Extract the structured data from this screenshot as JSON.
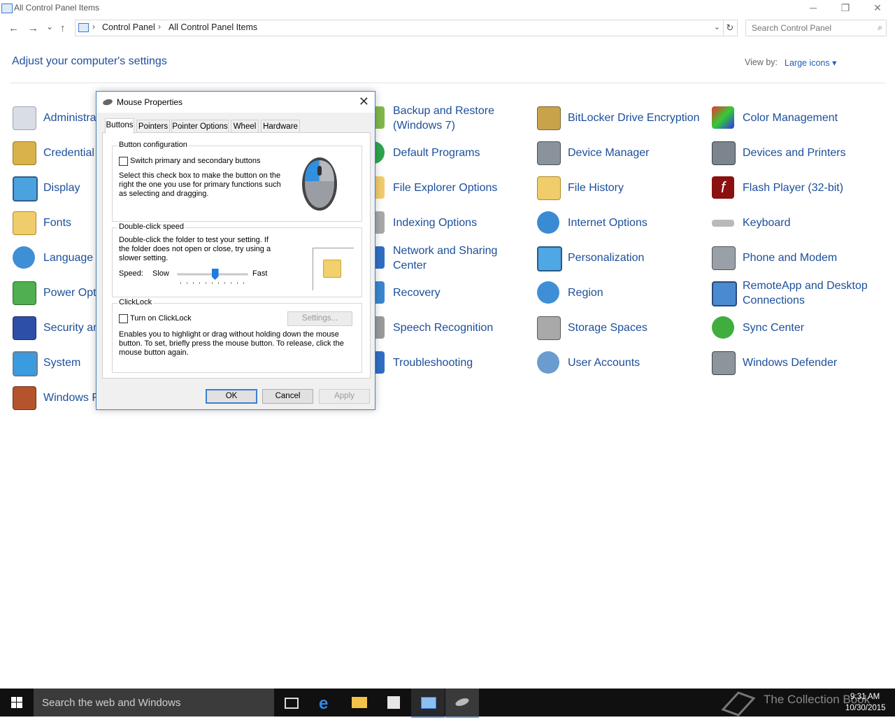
{
  "window": {
    "title": "All Control Panel Items",
    "min": "─",
    "restore": "❐",
    "close": "✕"
  },
  "nav": {
    "back": "←",
    "forward": "→",
    "recent": "⌄",
    "up": "↑"
  },
  "address": {
    "crumbs": [
      "Control Panel",
      "All Control Panel Items"
    ],
    "sep": "›",
    "refresh": "↻",
    "dropdown": "⌄"
  },
  "search": {
    "placeholder": "Search Control Panel",
    "icon": "⌕"
  },
  "heading": "Adjust your computer's settings",
  "view_by": {
    "label": "View by:",
    "value": "Large icons ▾"
  },
  "items": {
    "c0": [
      "Administrative Tools",
      "Credential Manager",
      "Display",
      "Fonts",
      "Language",
      "Power Options",
      "Security and Maintenance",
      "System",
      "Windows Firewall"
    ],
    "c2": [
      "Backup and Restore\n(Windows 7)",
      "Default Programs",
      "File Explorer Options",
      "Indexing Options",
      "Network and Sharing\nCenter",
      "Recovery",
      "Speech Recognition",
      "Troubleshooting"
    ],
    "c3": [
      "BitLocker Drive Encryption",
      "Device Manager",
      "File History",
      "Internet Options",
      "Personalization",
      "Region",
      "Storage Spaces",
      "User Accounts"
    ],
    "c4": [
      "Color Management",
      "Devices and Printers",
      "Flash Player (32-bit)",
      "Keyboard",
      "Phone and Modem",
      "RemoteApp and Desktop\nConnections",
      "Sync Center",
      "Windows Defender"
    ]
  },
  "dialog": {
    "title": "Mouse Properties",
    "close": "✕",
    "tabs": [
      "Buttons",
      "Pointers",
      "Pointer Options",
      "Wheel",
      "Hardware"
    ],
    "button_config": {
      "legend": "Button configuration",
      "checkbox": "Switch primary and secondary buttons",
      "desc": "Select this check box to make the button on the right the one you use for primary functions such as selecting and dragging."
    },
    "double_click": {
      "legend": "Double-click speed",
      "desc": "Double-click the folder to test your setting. If the folder does not open or close, try using a slower setting.",
      "speed_label": "Speed:",
      "slow": "Slow",
      "fast": "Fast",
      "speed_value": 0.55
    },
    "clicklock": {
      "legend": "ClickLock",
      "checkbox": "Turn on ClickLock",
      "settings": "Settings...",
      "desc": "Enables you to highlight or drag without holding down the mouse button. To set, briefly press the mouse button. To release, click the mouse button again."
    },
    "ok": "OK",
    "cancel": "Cancel",
    "apply": "Apply"
  },
  "taskbar": {
    "search": "Search the web and Windows",
    "time": "9:31 AM",
    "date": "10/30/2015",
    "watermark": "The Collection Book"
  }
}
